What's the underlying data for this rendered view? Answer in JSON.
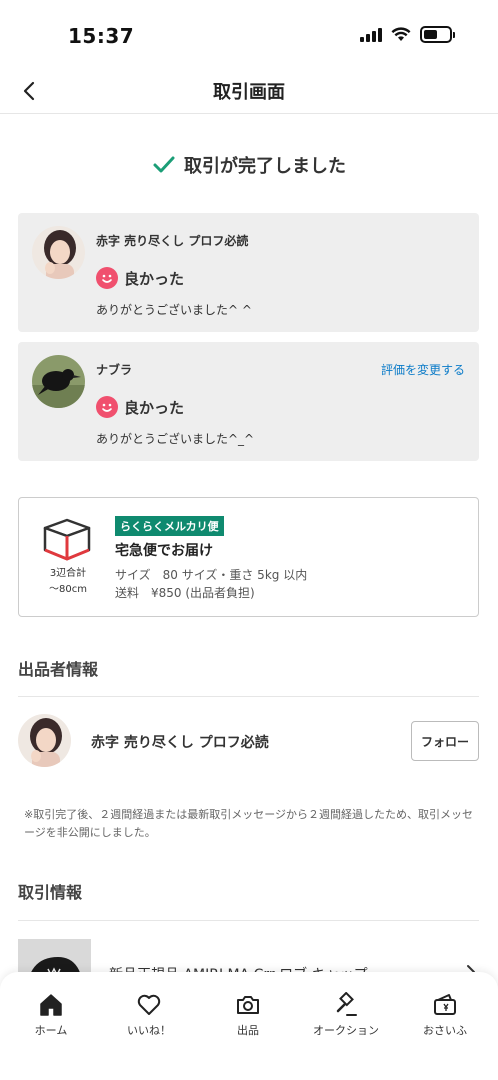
{
  "status_bar": {
    "time": "15:37"
  },
  "nav": {
    "title": "取引画面"
  },
  "completion": {
    "message": "取引が完了しました"
  },
  "reviews": [
    {
      "name": "赤字 売り尽くし プロフ必読",
      "rating": "良かった",
      "message": "ありがとうございました^ ^",
      "action": ""
    },
    {
      "name": "ナブラ",
      "rating": "良かった",
      "message": "ありがとうございました^_^",
      "action": "評価を変更する"
    }
  ],
  "shipping": {
    "box_size": "3辺合計",
    "box_size_value": "〜80cm",
    "badge": "らくらくメルカリ便",
    "method": "宅急便でお届け",
    "size": "サイズ　80 サイズ・重さ 5kg 以内",
    "fee": "送料　¥850 (出品者負担)"
  },
  "seller_section": {
    "title": "出品者情報",
    "name": "赤字 売り尽くし プロフ必読",
    "follow_label": "フォロー"
  },
  "notice": "※取引完了後、２週間経過または最新取引メッセージから２週間経過したため、取引メッセージを非公開にしました。",
  "trade_section": {
    "title": "取引情報",
    "product_title": "新品正規品 AMIRI MA Crr ロブ キャップ"
  },
  "tabs": [
    {
      "label": "ホーム",
      "icon": "home-icon"
    },
    {
      "label": "いいね！",
      "icon": "heart-icon"
    },
    {
      "label": "出品",
      "icon": "camera-icon"
    },
    {
      "label": "オークション",
      "icon": "gavel-icon"
    },
    {
      "label": "おさいふ",
      "icon": "wallet-icon"
    }
  ],
  "colors": {
    "check": "#1b9e77",
    "smile": "#f0506e",
    "link": "#0b7bc8",
    "badge": "#0f8a6f"
  }
}
